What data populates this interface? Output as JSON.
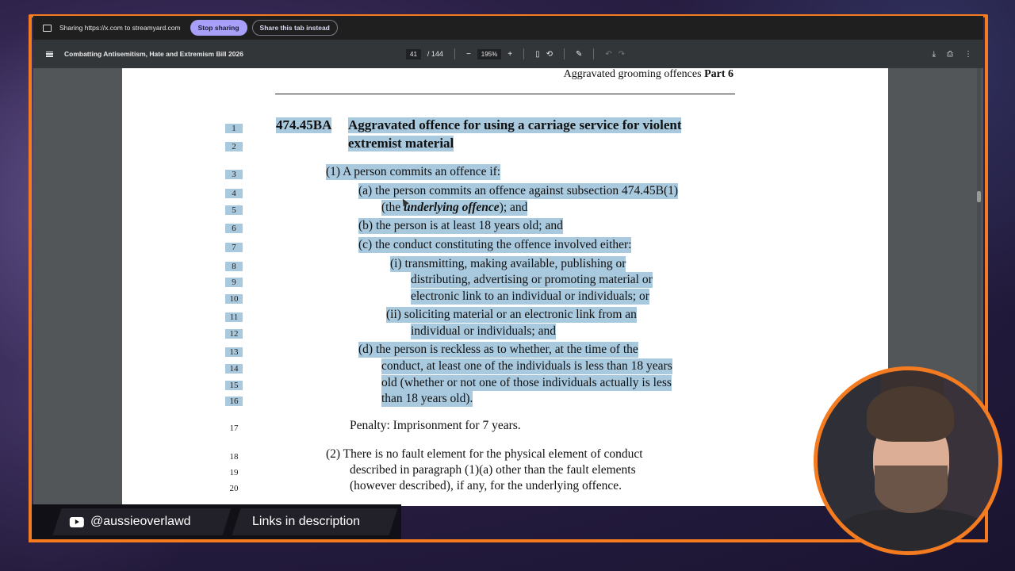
{
  "share_bar": {
    "sharing_text": "Sharing https://x.com to streamyard.com",
    "stop_label": "Stop sharing",
    "share_tab_label": "Share this tab instead"
  },
  "pdf_toolbar": {
    "title": "Combatting Antisemitism, Hate and Extremism Bill 2026",
    "current_page": "41",
    "total_pages": "/ 144",
    "zoom": "195%",
    "zoom_out": "−",
    "zoom_in": "+"
  },
  "document": {
    "running_head": "Aggravated grooming offences",
    "running_head_part": "Part 6",
    "section_number": "474.45BA",
    "heading_line1": "Aggravated offence for using a carriage service for violent",
    "heading_line2": "extremist material",
    "lines": [
      {
        "n": "1"
      },
      {
        "n": "2"
      },
      {
        "n": "3",
        "text": "(1)  A person commits an offence if:"
      },
      {
        "n": "4",
        "text": "(a)  the person commits an offence against subsection 474.45B(1)"
      },
      {
        "n": "5",
        "pre": "(the ",
        "em": "underlying offence",
        "post": "); and"
      },
      {
        "n": "6",
        "text": "(b)  the person is at least 18 years old; and"
      },
      {
        "n": "7",
        "text": "(c)  the conduct constituting the offence involved either:"
      },
      {
        "n": "8",
        "text": "(i)  transmitting, making available, publishing or"
      },
      {
        "n": "9",
        "text": "distributing, advertising or promoting material or"
      },
      {
        "n": "10",
        "text": "electronic link to an individual or individuals; or"
      },
      {
        "n": "11",
        "text": "(ii)  soliciting material or an electronic link from an"
      },
      {
        "n": "12",
        "text": "individual or individuals; and"
      },
      {
        "n": "13",
        "text": "(d)  the person is reckless as to whether, at the time of the"
      },
      {
        "n": "14",
        "text": "conduct, at least one of the individuals is less than 18 years"
      },
      {
        "n": "15",
        "text": "old (whether or not one of those individuals actually is less"
      },
      {
        "n": "16",
        "text": "than 18 years old)."
      },
      {
        "n": "17",
        "text": "Penalty:  Imprisonment for 7 years."
      },
      {
        "n": "18",
        "text": "(2)  There is no fault element for the physical element of conduct"
      },
      {
        "n": "19",
        "text": "described in paragraph (1)(a) other than the fault elements"
      },
      {
        "n": "20",
        "text": "(however described), if any, for the underlying offence."
      }
    ]
  },
  "overlay": {
    "handle": "@aussieoverlawd",
    "links_label": "Links in description"
  },
  "colors": {
    "accent": "#f47b20",
    "highlight": "#a9c9de",
    "stop_button": "#a8a0f8"
  }
}
